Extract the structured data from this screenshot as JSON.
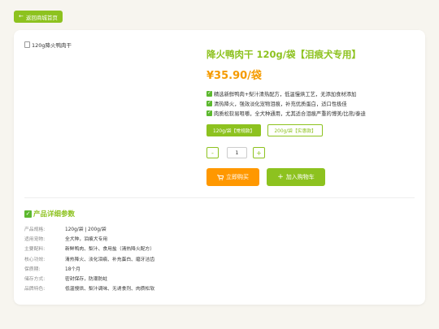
{
  "nav": {
    "back_arrow": "🡐",
    "back_label": "返回商城首页",
    "back_icon": "arrow-left-icon"
  },
  "product": {
    "image_alt": "120g降火鸭肉干",
    "title": "降火鸭肉干 120g/袋【泪痕犬专用】",
    "price": "¥35.90/袋",
    "features": [
      "精选新鲜鸭肉+梨汁清热配方，低温慢烘工艺，无添加食材添加",
      "清热降火，强效淡化宠物泪痕，补充优质蛋白，适口性极佳",
      "肉质松软易咀嚼，全犬种通用，尤其适合泪痕严重的博美/比熊/泰迪"
    ],
    "specs": [
      {
        "label": "120g/袋【常规款】",
        "selected": true
      },
      {
        "label": "200g/袋【实惠款】",
        "selected": false
      }
    ],
    "quantity": {
      "minus": "-",
      "value": "1",
      "plus": "+"
    },
    "buy_label": "立即购买",
    "cart_label": "加入购物车"
  },
  "details": {
    "title": "产品详细参数",
    "params": [
      {
        "label": "产品规格:",
        "value": "120g/袋 | 200g/袋"
      },
      {
        "label": "适用宠物:",
        "value": "全犬种，泪痕犬专用"
      },
      {
        "label": "主要配料:",
        "value": "新鲜鸭肉、梨汁、食用盐（清热降火配方）"
      },
      {
        "label": "核心功效:",
        "value": "清热降火、淡化泪痕、补充蛋白、磨牙洁齿"
      },
      {
        "label": "保质期:",
        "value": "18个月"
      },
      {
        "label": "储存方式:",
        "value": "密封保存，防潮防蛀"
      },
      {
        "label": "品牌特色:",
        "value": "低温慢烘、梨汁调味、无诱食剂、肉质松软"
      }
    ]
  },
  "colors": {
    "brand": "#8dc21f",
    "accent": "#f59b00",
    "check": "#5cb82e"
  }
}
